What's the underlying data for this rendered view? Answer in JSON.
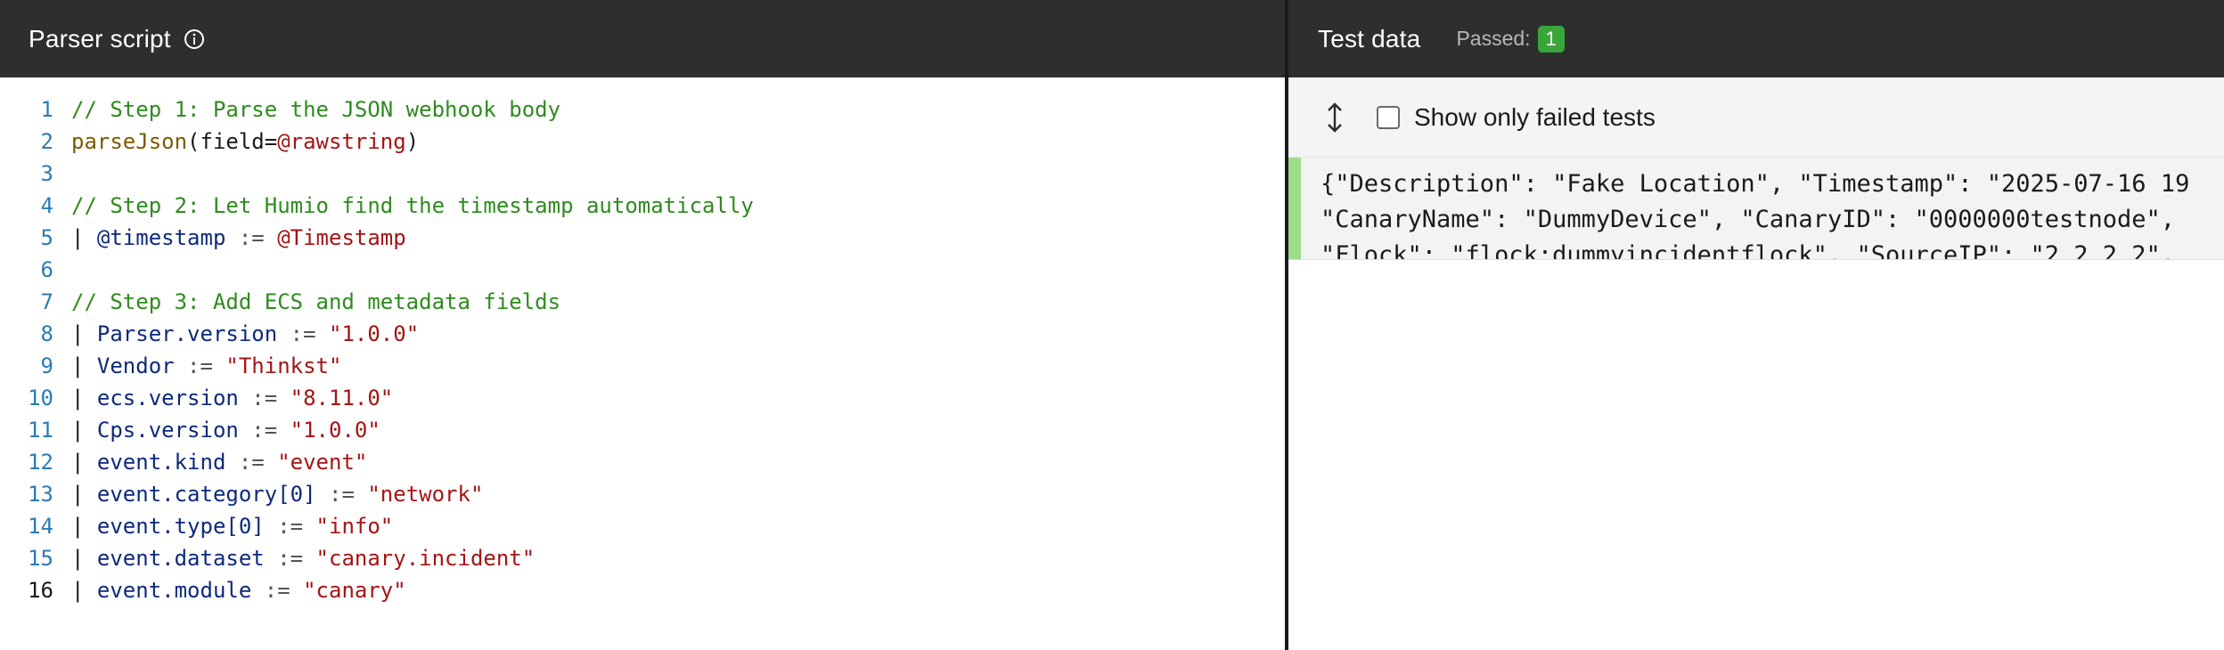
{
  "parser_panel": {
    "title": "Parser script",
    "info_icon": "info-icon",
    "lines": [
      {
        "num": "1",
        "parts": [
          {
            "t": "// Step 1: Parse the JSON webhook body",
            "c": "cm"
          }
        ]
      },
      {
        "num": "2",
        "parts": [
          {
            "t": "parseJson",
            "c": "fn"
          },
          {
            "t": "(field=",
            "c": "plain"
          },
          {
            "t": "@rawstring",
            "c": "str"
          },
          {
            "t": ")",
            "c": "plain"
          }
        ]
      },
      {
        "num": "3",
        "parts": []
      },
      {
        "num": "4",
        "parts": [
          {
            "t": "// Step 2: Let Humio find the timestamp automatically",
            "c": "cm"
          }
        ]
      },
      {
        "num": "5",
        "parts": [
          {
            "t": "| ",
            "c": "pipe"
          },
          {
            "t": "@timestamp",
            "c": "fld"
          },
          {
            "t": " := ",
            "c": "op"
          },
          {
            "t": "@Timestamp",
            "c": "str"
          }
        ]
      },
      {
        "num": "6",
        "parts": []
      },
      {
        "num": "7",
        "parts": [
          {
            "t": "// Step 3: Add ECS and metadata fields",
            "c": "cm"
          }
        ]
      },
      {
        "num": "8",
        "parts": [
          {
            "t": "| ",
            "c": "pipe"
          },
          {
            "t": "Parser.version",
            "c": "fld"
          },
          {
            "t": " := ",
            "c": "op"
          },
          {
            "t": "\"1.0.0\"",
            "c": "str"
          }
        ]
      },
      {
        "num": "9",
        "parts": [
          {
            "t": "| ",
            "c": "pipe"
          },
          {
            "t": "Vendor",
            "c": "fld"
          },
          {
            "t": " := ",
            "c": "op"
          },
          {
            "t": "\"Thinkst\"",
            "c": "str"
          }
        ]
      },
      {
        "num": "10",
        "parts": [
          {
            "t": "| ",
            "c": "pipe"
          },
          {
            "t": "ecs.version",
            "c": "fld"
          },
          {
            "t": " := ",
            "c": "op"
          },
          {
            "t": "\"8.11.0\"",
            "c": "str"
          }
        ]
      },
      {
        "num": "11",
        "parts": [
          {
            "t": "| ",
            "c": "pipe"
          },
          {
            "t": "Cps.version",
            "c": "fld"
          },
          {
            "t": " := ",
            "c": "op"
          },
          {
            "t": "\"1.0.0\"",
            "c": "str"
          }
        ]
      },
      {
        "num": "12",
        "parts": [
          {
            "t": "| ",
            "c": "pipe"
          },
          {
            "t": "event.kind",
            "c": "fld"
          },
          {
            "t": " := ",
            "c": "op"
          },
          {
            "t": "\"event\"",
            "c": "str"
          }
        ]
      },
      {
        "num": "13",
        "parts": [
          {
            "t": "| ",
            "c": "pipe"
          },
          {
            "t": "event.category[0]",
            "c": "fld"
          },
          {
            "t": " := ",
            "c": "op"
          },
          {
            "t": "\"network\"",
            "c": "str"
          }
        ]
      },
      {
        "num": "14",
        "parts": [
          {
            "t": "| ",
            "c": "pipe"
          },
          {
            "t": "event.type[0]",
            "c": "fld"
          },
          {
            "t": " := ",
            "c": "op"
          },
          {
            "t": "\"info\"",
            "c": "str"
          }
        ]
      },
      {
        "num": "15",
        "parts": [
          {
            "t": "| ",
            "c": "pipe"
          },
          {
            "t": "event.dataset",
            "c": "fld"
          },
          {
            "t": " := ",
            "c": "op"
          },
          {
            "t": "\"canary.incident\"",
            "c": "str"
          }
        ]
      },
      {
        "num": "16",
        "parts": [
          {
            "t": "| ",
            "c": "pipe"
          },
          {
            "t": "event.module",
            "c": "fld"
          },
          {
            "t": " := ",
            "c": "op"
          },
          {
            "t": "\"canary\"",
            "c": "str"
          }
        ],
        "active": true
      }
    ]
  },
  "test_panel": {
    "title": "Test data",
    "passed_label": "Passed:",
    "passed_count": "1",
    "sort_icon": "sort-vertical-icon",
    "filter_label": "Show only failed tests",
    "filter_checked": false,
    "test_case_lines": [
      "{\"Description\": \"Fake Location\", \"Timestamp\": \"2025-07-16 19",
      "\"CanaryName\": \"DummyDevice\", \"CanaryID\": \"0000000testnode\",",
      "\"Flock\": \"flock:dummyincidentflock\", \"SourceIP\": \"2.2.2.2\","
    ]
  },
  "colors": {
    "header_bg": "#2e2e2e",
    "badge_green": "#3aa63a",
    "pass_bar": "#9fdc8d",
    "comment": "#2e8b1e",
    "string": "#a31515",
    "field": "#0c2a7a"
  }
}
